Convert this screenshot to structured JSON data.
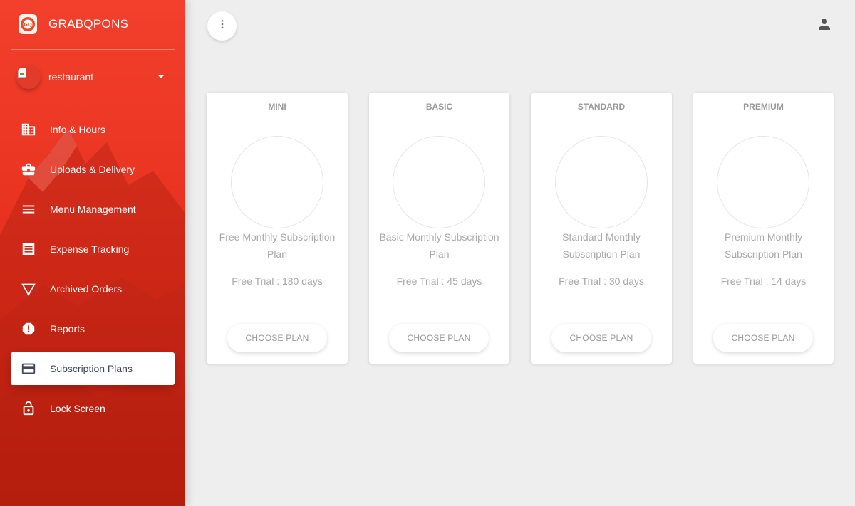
{
  "brand": {
    "name": "GRABQPONS",
    "logo_text": "GQ"
  },
  "user": {
    "name": "restaurant"
  },
  "sidebar": {
    "items": [
      {
        "label": "Info & Hours",
        "icon": "building-icon"
      },
      {
        "label": "Uploads & Delivery",
        "icon": "briefcase-icon"
      },
      {
        "label": "Menu Management",
        "icon": "menu-lines-icon"
      },
      {
        "label": "Expense Tracking",
        "icon": "receipt-icon"
      },
      {
        "label": "Archived Orders",
        "icon": "triangle-down-icon"
      },
      {
        "label": "Reports",
        "icon": "alert-octagon-icon"
      },
      {
        "label": "Subscription Plans",
        "icon": "credit-card-icon",
        "active": true
      },
      {
        "label": "Lock Screen",
        "icon": "lock-open-icon"
      }
    ]
  },
  "topbar": {
    "menu_icon": "more-vert-icon",
    "profile_icon": "person-icon"
  },
  "plans": [
    {
      "name": "MINI",
      "description": "Free Monthly Subscription Plan",
      "trial": "Free Trial : 180 days",
      "button": "CHOOSE PLAN"
    },
    {
      "name": "BASIC",
      "description": "Basic Monthly Subscription Plan",
      "trial": "Free Trial : 45 days",
      "button": "CHOOSE PLAN"
    },
    {
      "name": "STANDARD",
      "description": "Standard Monthly Subscription Plan",
      "trial": "Free Trial : 30 days",
      "button": "CHOOSE PLAN"
    },
    {
      "name": "PREMIUM",
      "description": "Premium Monthly Subscription Plan",
      "trial": "Free Trial : 14 days",
      "button": "CHOOSE PLAN"
    }
  ],
  "colors": {
    "accent": "#e8321f",
    "active_text": "#3c4858",
    "card_text": "#a9a9a9"
  }
}
